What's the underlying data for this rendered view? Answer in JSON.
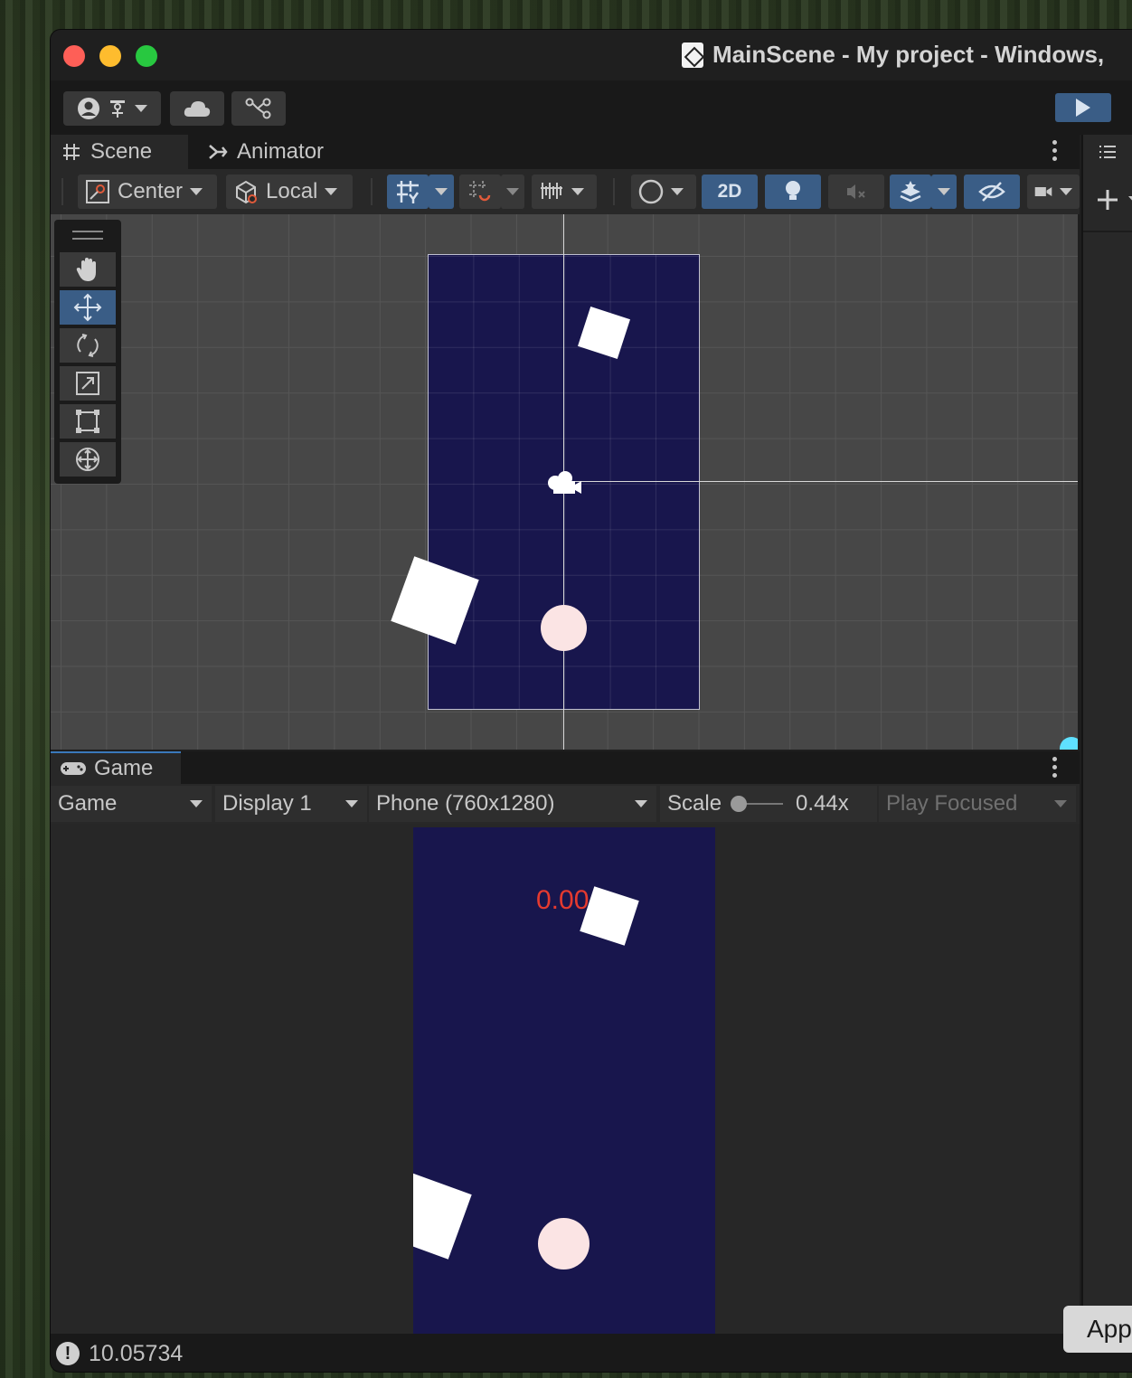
{
  "window": {
    "title": "MainScene - My project - Windows,"
  },
  "toolbar": {
    "account_icon": "account-icon",
    "cloud_icon": "cloud-icon",
    "collab_icon": "version-control-icon",
    "play_icon": "play-icon"
  },
  "scene_panel": {
    "tab_scene": "Scene",
    "tab_animator": "Animator",
    "pivot_label": "Center",
    "space_label": "Local",
    "mode_2d": "2D"
  },
  "game_panel": {
    "tab_label": "Game",
    "view_select": "Game",
    "display_select": "Display 1",
    "resolution_select": "Phone (760x1280)",
    "scale_label": "Scale",
    "scale_value": "0.44x",
    "scale_fraction": 0.0,
    "play_focus_select": "Play Focused",
    "score_text": "0.00"
  },
  "status_bar": {
    "message": "10.05734"
  },
  "app_button": {
    "label": "App"
  },
  "colors": {
    "camera_background": "#18164d",
    "score": "#e53a2f",
    "accent_blue": "#3a5d86",
    "ball": "#fbe4e4"
  }
}
